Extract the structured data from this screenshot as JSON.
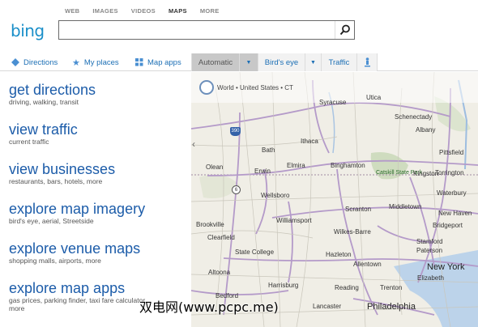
{
  "header": {
    "logo": "bing",
    "nav": [
      "WEB",
      "IMAGES",
      "VIDEOS",
      "MAPS",
      "MORE"
    ],
    "nav_active": "MAPS",
    "search_value": "",
    "search_icon": "magnifier"
  },
  "toolbar": {
    "directions": "Directions",
    "myplaces": "My places",
    "mapapps": "Map apps",
    "automatic": "Automatic",
    "birdseye": "Bird's eye",
    "traffic": "Traffic"
  },
  "panel": {
    "items": [
      {
        "title": "get directions",
        "sub": "driving, walking, transit"
      },
      {
        "title": "view traffic",
        "sub": "current traffic"
      },
      {
        "title": "view businesses",
        "sub": "restaurants, bars, hotels, more"
      },
      {
        "title": "explore map imagery",
        "sub": "bird's eye, aerial, Streetside"
      },
      {
        "title": "explore venue maps",
        "sub": "shopping malls, airports, more"
      },
      {
        "title": "explore map apps",
        "sub": "gas prices, parking finder, taxi fare calculator,",
        "sub2": "more"
      }
    ]
  },
  "map": {
    "breadcrumb": "World • United States • CT",
    "cities": {
      "syracuse": "Syracuse",
      "utica": "Utica",
      "schenectady": "Schenectady",
      "albany": "Albany",
      "ithaca": "Ithaca",
      "bath": "Bath",
      "olean": "Olean",
      "erwin": "Erwin",
      "elmira": "Elmira",
      "binghamton": "Binghamton",
      "pittsfield": "Pittsfield",
      "catskill": "Catskill State Park",
      "kingston": "Kingston",
      "torrington": "Torrington",
      "wellsboro": "Wellsboro",
      "scranton": "Scranton",
      "middletown": "Middletown",
      "waterbury": "Waterbury",
      "williamsport": "Williamsport",
      "newhaven": "New Haven",
      "bridgeport": "Bridgeport",
      "stamford": "Stamford",
      "wilkesbarre": "Wilkes-Barre",
      "brookville": "Brookville",
      "clearfield": "Clearfield",
      "statecollege": "State College",
      "hazleton": "Hazleton",
      "paterson": "Paterson",
      "newyork": "New York",
      "allentown": "Allentown",
      "elizabeth": "Elizabeth",
      "altoona": "Altoona",
      "harrisburg": "Harrisburg",
      "reading": "Reading",
      "trenton": "Trenton",
      "bedford": "Bedford",
      "lancaster": "Lancaster",
      "philadelphia": "Philadelphia"
    },
    "shields": {
      "i390": "390",
      "r6": "6"
    }
  },
  "watermark": "双电网(www.pcpc.me)",
  "colors": {
    "link": "#1c5ca9",
    "logo": "#1a8fc9",
    "map_bg": "#f0eee6",
    "road": "#b49ac9"
  }
}
